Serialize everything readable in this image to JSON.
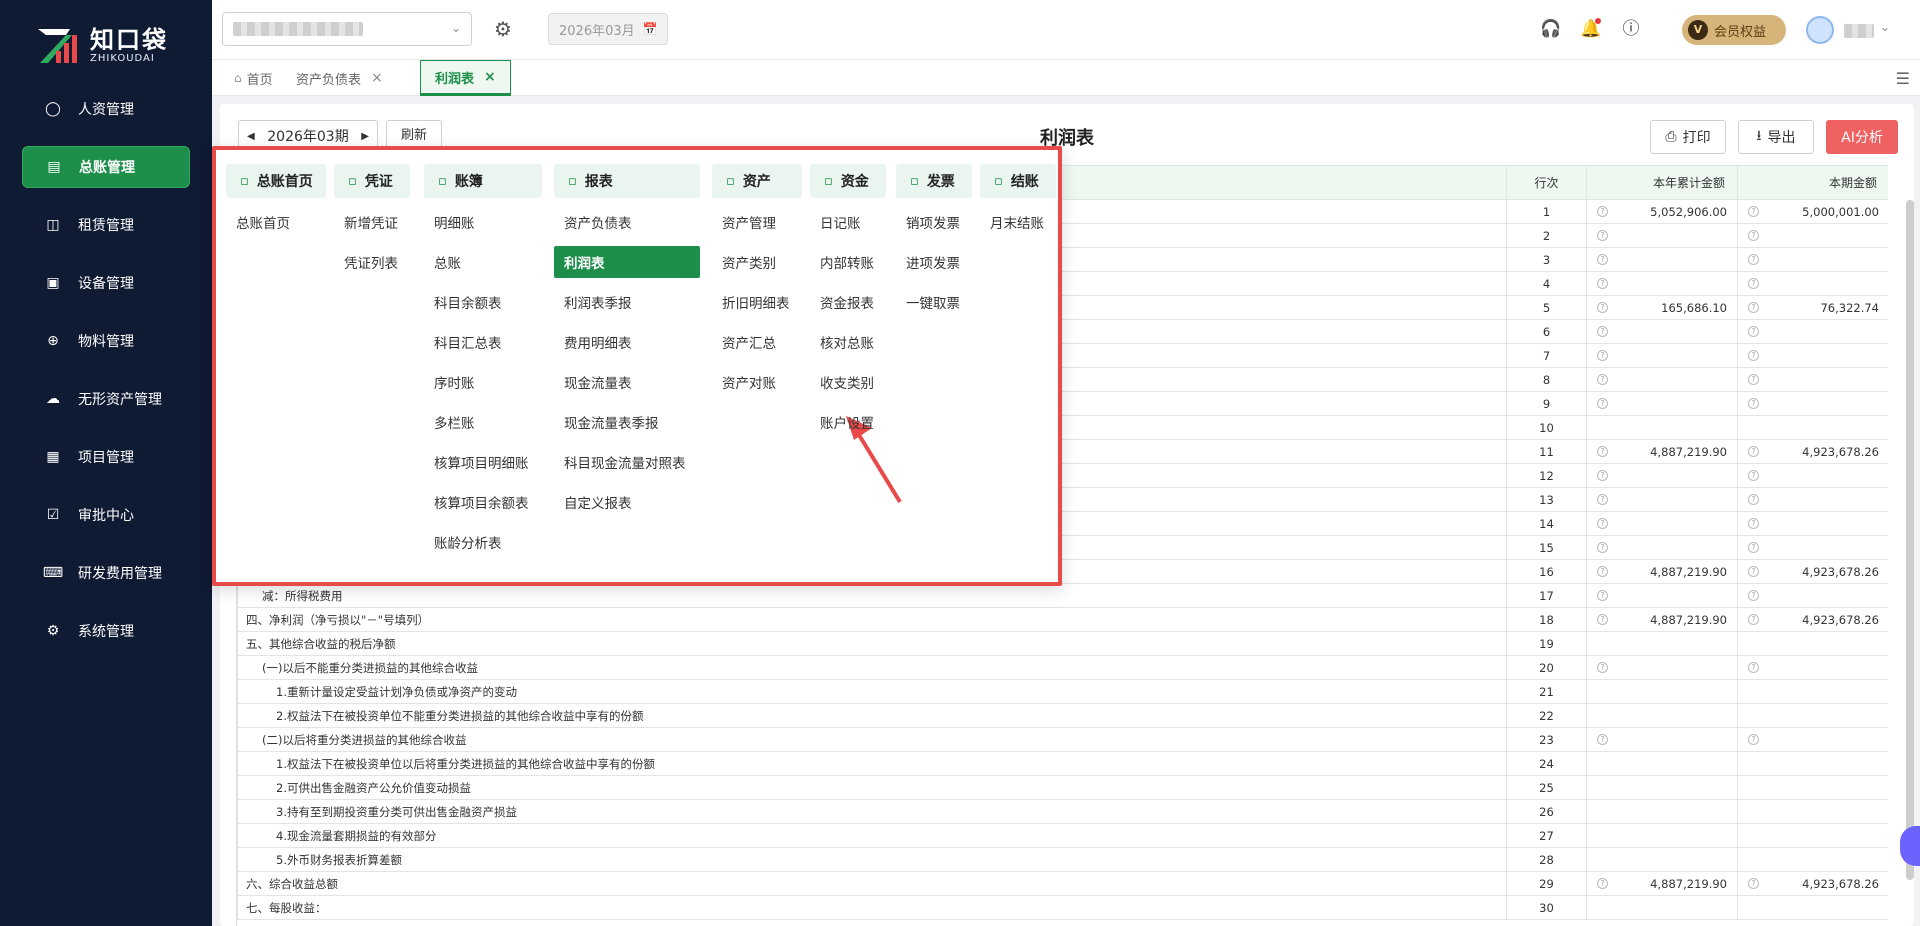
{
  "brand": {
    "name_cn": "知口袋",
    "name_en": "ZHIKOUDAI",
    "color": "#1d8f4a"
  },
  "sidebar": {
    "items": [
      {
        "label": "人资管理",
        "icon": "user-shield-icon",
        "active": false
      },
      {
        "label": "总账管理",
        "icon": "ledger-icon",
        "active": true
      },
      {
        "label": "租赁管理",
        "icon": "lease-icon",
        "active": false
      },
      {
        "label": "设备管理",
        "icon": "device-icon",
        "active": false
      },
      {
        "label": "物料管理",
        "icon": "material-icon",
        "active": false
      },
      {
        "label": "无形资产管理",
        "icon": "intangible-icon",
        "active": false
      },
      {
        "label": "项目管理",
        "icon": "project-icon",
        "active": false
      },
      {
        "label": "审批中心",
        "icon": "approval-icon",
        "active": false
      },
      {
        "label": "研发费用管理",
        "icon": "rd-icon",
        "active": false
      },
      {
        "label": "系统管理",
        "icon": "gear-icon",
        "active": false
      }
    ]
  },
  "header": {
    "period_placeholder": "2026年03月",
    "member_label": "会员权益",
    "member_badge": "V"
  },
  "tabs": [
    {
      "label": "首页",
      "closable": false,
      "active": false
    },
    {
      "label": "资产负债表",
      "closable": true,
      "active": false
    },
    {
      "label": "利润表",
      "closable": true,
      "active": true
    }
  ],
  "report": {
    "period": "2026年03期",
    "refresh_label": "刷新",
    "title": "利润表",
    "print_label": "打印",
    "export_label": "导出",
    "ai_label": "AI分析",
    "columns": {
      "line_no": "行次",
      "ytd": "本年累计金额",
      "current": "本期金额"
    },
    "rows": [
      {
        "item": "",
        "level": 0,
        "no": "1",
        "ytd": "5,052,906.00",
        "cur": "5,000,001.00",
        "qm": true
      },
      {
        "item": "",
        "level": 0,
        "no": "2",
        "ytd": "",
        "cur": "",
        "qm": true
      },
      {
        "item": "",
        "level": 0,
        "no": "3",
        "ytd": "",
        "cur": "",
        "qm": true
      },
      {
        "item": "",
        "level": 0,
        "no": "4",
        "ytd": "",
        "cur": "",
        "qm": true
      },
      {
        "item": "",
        "level": 0,
        "no": "5",
        "ytd": "165,686.10",
        "cur": "76,322.74",
        "qm": true
      },
      {
        "item": "",
        "level": 0,
        "no": "6",
        "ytd": "",
        "cur": "",
        "qm": true
      },
      {
        "item": "",
        "level": 0,
        "no": "7",
        "ytd": "",
        "cur": "",
        "qm": true
      },
      {
        "item": "",
        "level": 0,
        "no": "8",
        "ytd": "",
        "cur": "",
        "qm": true
      },
      {
        "item": "",
        "level": 0,
        "no": "9",
        "ytd": "",
        "cur": "",
        "qm": true
      },
      {
        "item": "",
        "level": 0,
        "no": "10",
        "ytd": "",
        "cur": "",
        "qm": false
      },
      {
        "item": "",
        "level": 0,
        "no": "11",
        "ytd": "4,887,219.90",
        "cur": "4,923,678.26",
        "qm": true
      },
      {
        "item": "",
        "level": 0,
        "no": "12",
        "ytd": "",
        "cur": "",
        "qm": true
      },
      {
        "item": "",
        "level": 0,
        "no": "13",
        "ytd": "",
        "cur": "",
        "qm": true
      },
      {
        "item": "",
        "level": 0,
        "no": "14",
        "ytd": "",
        "cur": "",
        "qm": true
      },
      {
        "item": "",
        "level": 0,
        "no": "15",
        "ytd": "",
        "cur": "",
        "qm": true
      },
      {
        "item": "",
        "level": 0,
        "no": "16",
        "ytd": "4,887,219.90",
        "cur": "4,923,678.26",
        "qm": true
      },
      {
        "item": "减：所得税费用",
        "level": 1,
        "no": "17",
        "ytd": "",
        "cur": "",
        "qm": true
      },
      {
        "item": "四、净利润（净亏损以\"－\"号填列）",
        "level": 0,
        "no": "18",
        "ytd": "4,887,219.90",
        "cur": "4,923,678.26",
        "qm": true
      },
      {
        "item": "五、其他综合收益的税后净额",
        "level": 0,
        "no": "19",
        "ytd": "",
        "cur": "",
        "qm": false
      },
      {
        "item": "(一)以后不能重分类进损益的其他综合收益",
        "level": 1,
        "no": "20",
        "ytd": "",
        "cur": "",
        "qm": true
      },
      {
        "item": "1.重新计量设定受益计划净负债或净资产的变动",
        "level": 2,
        "no": "21",
        "ytd": "",
        "cur": "",
        "qm": false
      },
      {
        "item": "2.权益法下在被投资单位不能重分类进损益的其他综合收益中享有的份额",
        "level": 2,
        "no": "22",
        "ytd": "",
        "cur": "",
        "qm": false
      },
      {
        "item": "(二)以后将重分类进损益的其他综合收益",
        "level": 1,
        "no": "23",
        "ytd": "",
        "cur": "",
        "qm": true
      },
      {
        "item": "1.权益法下在被投资单位以后将重分类进损益的其他综合收益中享有的份额",
        "level": 2,
        "no": "24",
        "ytd": "",
        "cur": "",
        "qm": false
      },
      {
        "item": "2.可供出售金融资产公允价值变动损益",
        "level": 2,
        "no": "25",
        "ytd": "",
        "cur": "",
        "qm": false
      },
      {
        "item": "3.持有至到期投资重分类可供出售金融资产损益",
        "level": 2,
        "no": "26",
        "ytd": "",
        "cur": "",
        "qm": false
      },
      {
        "item": "4.现金流量套期损益的有效部分",
        "level": 2,
        "no": "27",
        "ytd": "",
        "cur": "",
        "qm": false
      },
      {
        "item": "5.外币财务报表折算差额",
        "level": 2,
        "no": "28",
        "ytd": "",
        "cur": "",
        "qm": false
      },
      {
        "item": "六、综合收益总额",
        "level": 0,
        "no": "29",
        "ytd": "4,887,219.90",
        "cur": "4,923,678.26",
        "qm": true
      },
      {
        "item": "七、每股收益：",
        "level": 0,
        "no": "30",
        "ytd": "",
        "cur": "",
        "qm": false
      }
    ]
  },
  "menu": {
    "columns": [
      {
        "head": "总账首页",
        "icon": "home-ledger-icon",
        "items": [
          "总账首页"
        ]
      },
      {
        "head": "凭证",
        "icon": "voucher-icon",
        "items": [
          "新增凭证",
          "凭证列表"
        ]
      },
      {
        "head": "账簿",
        "icon": "book-icon",
        "items": [
          "明细账",
          "总账",
          "科目余额表",
          "科目汇总表",
          "序时账",
          "多栏账",
          "核算项目明细账",
          "核算项目余额表",
          "账龄分析表"
        ]
      },
      {
        "head": "报表",
        "icon": "report-icon",
        "items": [
          "资产负债表",
          "利润表",
          "利润表季报",
          "费用明细表",
          "现金流量表",
          "现金流量表季报",
          "科目现金流量对照表",
          "自定义报表"
        ],
        "active_item": "利润表"
      },
      {
        "head": "资产",
        "icon": "asset-icon",
        "items": [
          "资产管理",
          "资产类别",
          "折旧明细表",
          "资产汇总",
          "资产对账"
        ]
      },
      {
        "head": "资金",
        "icon": "fund-icon",
        "items": [
          "日记账",
          "内部转账",
          "资金报表",
          "核对总账",
          "收支类别",
          "账户设置"
        ]
      },
      {
        "head": "发票",
        "icon": "invoice-icon",
        "items": [
          "销项发票",
          "进项发票",
          "一键取票"
        ]
      },
      {
        "head": "结账",
        "icon": "close-period-icon",
        "items": [
          "月末结账"
        ]
      }
    ]
  },
  "colors": {
    "primary": "#1d8f4a",
    "highlight_border": "#e84a4a",
    "ai_button": "#f06262",
    "sidebar_bg": "#0f1a33"
  }
}
